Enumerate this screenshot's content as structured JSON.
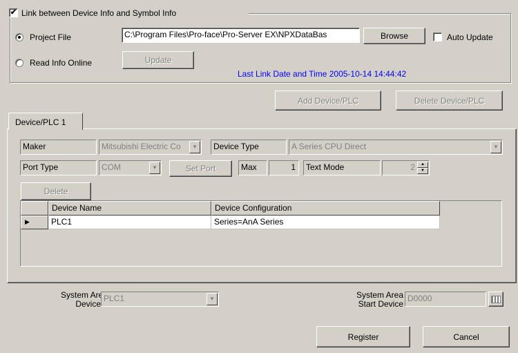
{
  "link_section": {
    "checkbox_label": "Link between Device Info and Symbol Info",
    "checked": true,
    "project_file_label": "Project File",
    "project_file_selected": true,
    "project_file_path": "C:\\Program Files\\Pro-face\\Pro-Server EX\\NPXDataBas",
    "browse_label": "Browse",
    "auto_update_label": "Auto Update",
    "auto_update_checked": false,
    "read_info_online_label": "Read Info Online",
    "update_label": "Update",
    "last_link_text": "Last Link Date and Time 2005-10-14 14:44:42"
  },
  "top_buttons": {
    "add_device": "Add Device/PLC",
    "delete_device": "Delete Device/PLC"
  },
  "tab": {
    "label": "Device/PLC 1"
  },
  "device": {
    "maker_label": "Maker",
    "maker_value": "Mitsubishi Electric Co",
    "device_type_label": "Device Type",
    "device_type_value": "A Series CPU Direct",
    "port_type_label": "Port Type",
    "port_type_value": "COM",
    "set_port_label": "Set Port",
    "max_label": "Max",
    "max_value": "1",
    "text_mode_label": "Text Mode",
    "text_mode_value": "2",
    "delete_label": "Delete"
  },
  "table": {
    "columns": [
      "Device Name",
      "Device Configuration"
    ],
    "rows": [
      {
        "name": "PLC1",
        "config": "Series=AnA Series"
      }
    ]
  },
  "system_area": {
    "device_label_line1": "System Area",
    "device_label_line2": "Device",
    "device_value": "PLC1",
    "start_label_line1": "System Area",
    "start_label_line2": "Start Device",
    "start_value": "D0000"
  },
  "footer": {
    "register_label": "Register",
    "cancel_label": "Cancel"
  },
  "colors": {
    "face": "#d4d0c8",
    "link_text": "#0000ff"
  }
}
